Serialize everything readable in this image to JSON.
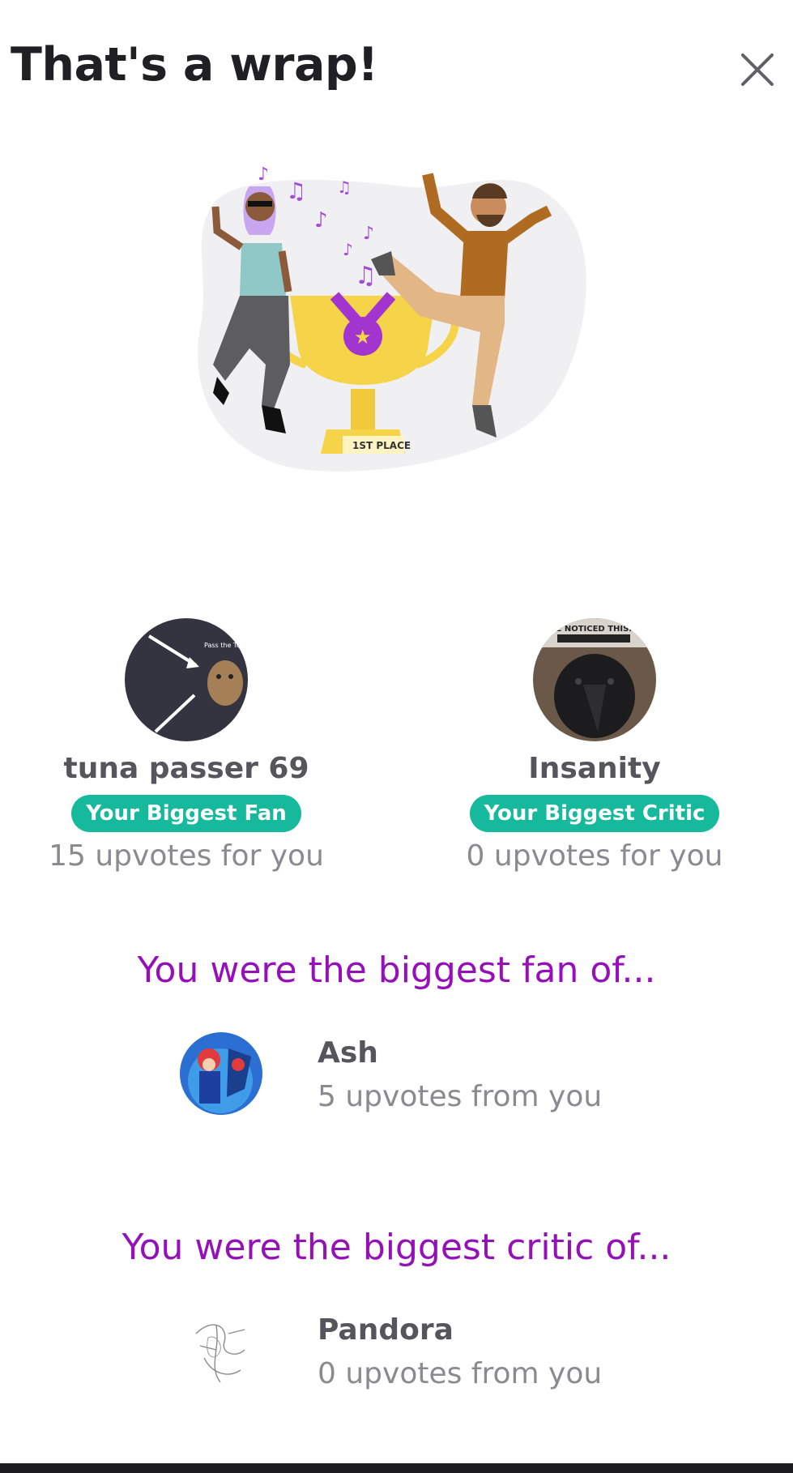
{
  "header": {
    "title": "That's a wrap!"
  },
  "hero": {
    "trophy_label": "1ST PLACE"
  },
  "biggest_fan": {
    "name": "tuna passer 69",
    "badge": "Your Biggest Fan",
    "stat": "15 upvotes for you",
    "avatar_caption": "Pass the Tuna down"
  },
  "biggest_critic": {
    "name": "Insanity",
    "badge": "Your Biggest Critic",
    "stat": "0 upvotes for you",
    "avatar_caption": "I'VE NOTICED THIS. I'M LOOKING AT YOU"
  },
  "fan_of": {
    "heading": "You were the biggest fan of...",
    "name": "Ash",
    "stat": "5 upvotes from you"
  },
  "critic_of": {
    "heading": "You were the biggest critic of...",
    "name": "Pandora",
    "stat": "0 upvotes from you"
  },
  "colors": {
    "accent_purple": "#9510b8",
    "badge_green": "#16b99c",
    "trophy_gold": "#f5d44a"
  }
}
